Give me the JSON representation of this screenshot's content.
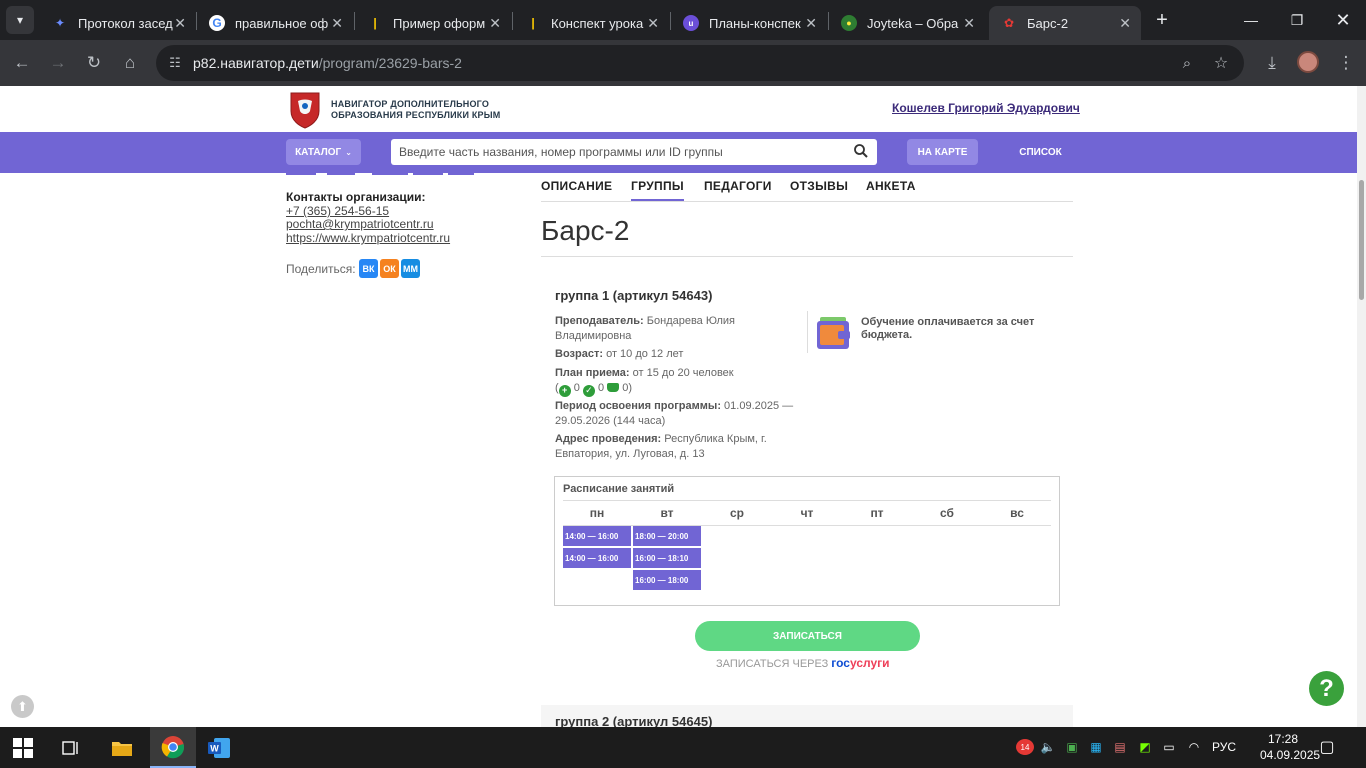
{
  "browser": {
    "tabs": [
      {
        "label": "Протокол засед",
        "icon": "blue-bird-icon"
      },
      {
        "label": "правильное оф",
        "icon": "google-icon"
      },
      {
        "label": "Пример оформ",
        "icon": "yandex-zen-icon"
      },
      {
        "label": "Конспект урока",
        "icon": "yandex-zen-icon"
      },
      {
        "label": "Планы-конспек",
        "icon": "infourok-icon"
      },
      {
        "label": "Joyteka – Обра",
        "icon": "joyteka-icon"
      },
      {
        "label": "Барс-2",
        "icon": "navigator-icon"
      }
    ],
    "url_host": "p82.навигатор.дети",
    "url_path": "/program/23629-bars-2"
  },
  "site": {
    "logo_line1": "НАВИГАТОР ДОПОЛНИТЕЛЬНОГО",
    "logo_line2": "ОБРАЗОВАНИЯ РЕСПУБЛИКИ КРЫМ",
    "user_name": "Кошелев Григорий Эдуардович",
    "catalog_label": "КАТАЛОГ",
    "search_placeholder": "Введите часть названия, номер программы или ID группы",
    "map_label": "НА КАРТЕ",
    "list_label": "СПИСОК"
  },
  "sidebar": {
    "contacts_title": "Контакты организации:",
    "phone": "+7 (365) 254-56-15",
    "email": "pochta@krympatriotcentr.ru",
    "website": "https://www.krympatriotcentr.ru",
    "share_label": "Поделиться:",
    "share_buttons": [
      "ВК",
      "ОК",
      "ММ"
    ]
  },
  "main": {
    "tabs": [
      "ОПИСАНИЕ",
      "ГРУППЫ",
      "ПЕДАГОГИ",
      "ОТЗЫВЫ",
      "АНКЕТА"
    ],
    "active_tab": "ГРУППЫ",
    "program_title": "Барс-2"
  },
  "group1": {
    "title": "группа 1 (артикул 54643)",
    "teacher_label": "Преподаватель:",
    "teacher_value": "Бондарева Юлия Владимировна",
    "age_label": "Возраст:",
    "age_value": "от 10 до 12 лет",
    "plan_label": "План приема:",
    "plan_value": "от 15 до 20 человек",
    "plan_counts": [
      "0",
      "0",
      "0"
    ],
    "period_label": "Период освоения программы:",
    "period_value": "01.09.2025 — 29.05.2026 (144 часа)",
    "address_label": "Адрес проведения:",
    "address_value": "Республика Крым, г. Евпатория, ул. Луговая, д. 13",
    "funding": "Обучение оплачивается за счет бюджета.",
    "schedule_title": "Расписание занятий",
    "days": [
      "пн",
      "вт",
      "ср",
      "чт",
      "пт",
      "сб",
      "вс"
    ],
    "slots": {
      "mon": [
        "14:00 — 16:00",
        "14:00 — 16:00"
      ],
      "tue": [
        "18:00 — 20:00",
        "16:00 — 18:10",
        "16:00 — 18:00"
      ]
    },
    "enroll_label": "ЗАПИСАТЬСЯ",
    "gos_prefix": "ЗАПИСАТЬСЯ ЧЕРЕЗ",
    "gos_part1": "гос",
    "gos_part2": "услуги"
  },
  "group2": {
    "title": "группа 2 (артикул 54645)"
  },
  "help_label": "?",
  "taskbar": {
    "lang": "РУС",
    "time": "17:28",
    "date": "04.09.2025",
    "notification_count": "14"
  },
  "colors": {
    "brand_purple": "#7165d4",
    "enroll_green": "#5fd884",
    "help_green": "#3aa13c"
  }
}
